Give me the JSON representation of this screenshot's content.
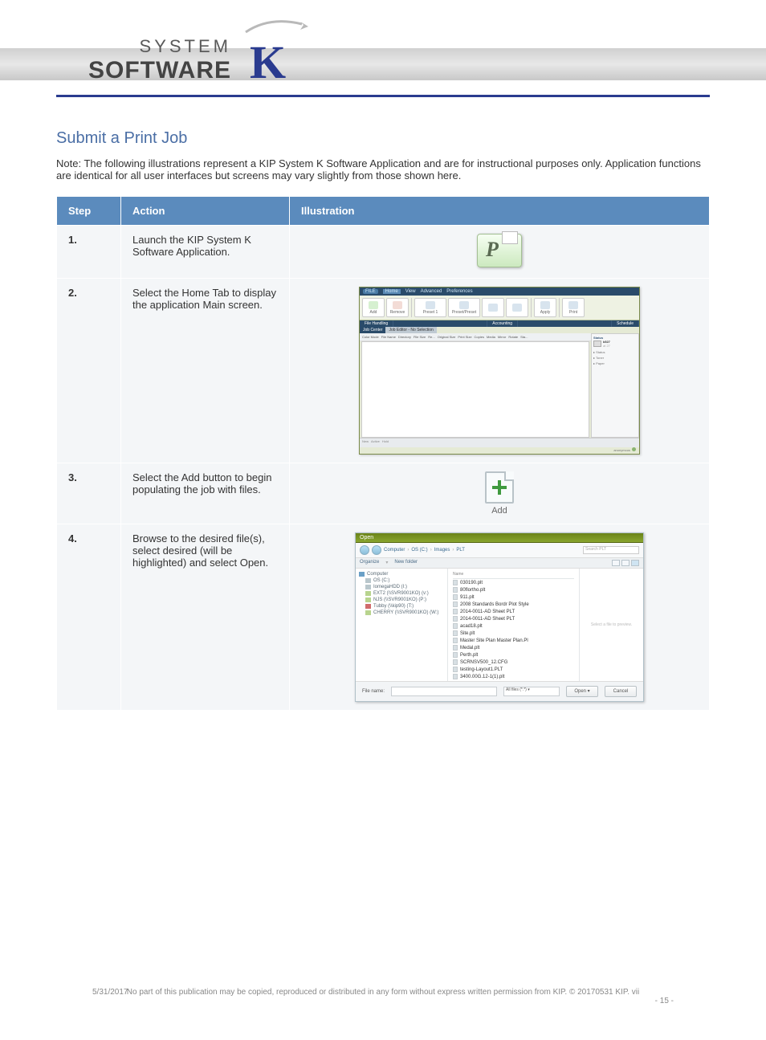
{
  "logo": {
    "system": "SYSTEM",
    "software": "SOFTWARE"
  },
  "section_title": "Submit a Print Job",
  "intro": "Note: The following illustrations represent a KIP System K Software Application and are for instructional purposes only. Application functions are identical for all user interfaces but screens may vary slightly from those shown here.",
  "headers": {
    "step": "Step",
    "action": "Action",
    "illustration": "Illustration"
  },
  "rows": {
    "1": {
      "num": "1.",
      "desc": "Launch the KIP System K Software Application."
    },
    "2": {
      "num": "2.",
      "desc": "Select the Home Tab to display the application Main screen."
    },
    "3": {
      "num": "3.",
      "desc": "Select the Add button to begin populating the job with files."
    },
    "4": {
      "num": "4.",
      "desc": "Browse to the desired file(s), select desired (will be highlighted) and select Open."
    }
  },
  "app": {
    "menu": {
      "file": "FILE",
      "home": "Home",
      "view": "View",
      "advanced": "Advanced",
      "preferences": "Preferences"
    },
    "toolbar": [
      "Add",
      "Remove",
      "",
      "Preset 1",
      "Preset/Preset",
      "",
      "Apply",
      "",
      "Print"
    ],
    "ribbon": [
      "File Handling",
      "",
      "",
      "Accounting",
      "",
      "",
      "Schedule"
    ],
    "jobcenter_tab": "Job Center",
    "jobcenter_tab2": "Job Editor - No Selection",
    "cols": [
      "",
      "Color Mode",
      "File Name",
      "Directory",
      "File Size",
      "Re...",
      "Original Size",
      "Print Size",
      "Copies",
      "Media",
      "Mirror",
      "Rotate",
      "Sta..."
    ],
    "status_title": "Status",
    "printer": "k527",
    "printer_sub": "at 27",
    "props": [
      "Status",
      "Toner",
      "Paper"
    ],
    "bottom": [
      "New",
      "Active",
      "Hold"
    ],
    "footer_user": "anonymous"
  },
  "add": {
    "label": "Add"
  },
  "dialog": {
    "title": "Open",
    "crumbs": [
      "Computer",
      "OS (C:)",
      "Images",
      "PLT"
    ],
    "search": "Search PLT",
    "organize": "Organize",
    "newfolder": "New folder",
    "nav": [
      {
        "icon": "computer",
        "label": "Computer"
      },
      {
        "icon": "drive",
        "label": "OS (C:)",
        "indent": 1
      },
      {
        "icon": "drive",
        "label": "IomegaHDD (I:)",
        "indent": 1
      },
      {
        "icon": "ext",
        "label": "EXT2 (\\\\SVR9001KO) (v:)",
        "indent": 1
      },
      {
        "icon": "ext",
        "label": "NJS (\\\\SVR9001KO) (P:)",
        "indent": 1
      },
      {
        "icon": "red",
        "label": "Tubby (\\\\kip90) (T:)",
        "indent": 1
      },
      {
        "icon": "ext",
        "label": "CHERRY (\\\\SVR9001KO) (W:)",
        "indent": 1
      }
    ],
    "files_hdr": "Name",
    "files": [
      "030190.plt",
      "80flortho.plt",
      "911.plt",
      "2008 Standards Bordr Plot Style",
      "2014-0011-AD Sheet PLT",
      "2014-0011-AD Sheet PLT",
      "acad18.plt",
      "Site.plt",
      "Master Site Plan Master Plan.Pl",
      "Medal.plt",
      "Perth.plt",
      "SCRNSV500_12.CFG",
      "testing-Layout1.PLT",
      "3400.00G.12-1(1).plt"
    ],
    "preview": "Select a file to preview.",
    "filename_label": "File name:",
    "filetype": "All files (*.*)",
    "open": "Open",
    "cancel": "Cancel"
  },
  "footer": {
    "date": "5/31/2017",
    "left": "No part of this publication may be copied, reproduced or distributed in any form without express written permission from KIP. © 20170531 KIP. vii",
    "page": "- 15 -"
  }
}
